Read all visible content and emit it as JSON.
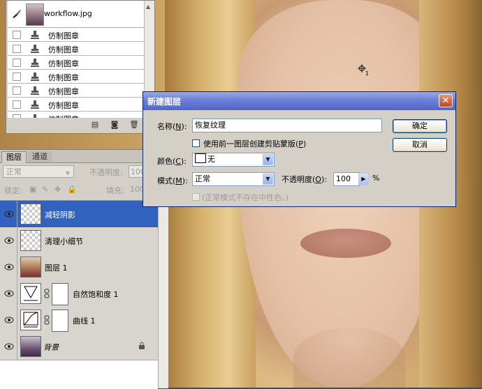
{
  "history": {
    "snapshot_name": "workflow.jpg",
    "items": [
      "仿制图章",
      "仿制图章",
      "仿制图章",
      "仿制图章",
      "仿制图章",
      "仿制图章",
      "仿制图章"
    ]
  },
  "layers_panel": {
    "tabs": [
      "图层",
      "通道"
    ],
    "blend_mode": "正常",
    "opacity_label": "不透明度:",
    "opacity_value": "100%",
    "lock_label": "锁定:",
    "fill_label": "填充:",
    "fill_value": "100%",
    "layers": [
      {
        "name": "减轻阴影",
        "selected": true,
        "kind": "transparent"
      },
      {
        "name": "清理小细节",
        "selected": false,
        "kind": "transparent"
      },
      {
        "name": "图层 1",
        "selected": false,
        "kind": "photo"
      },
      {
        "name": "自然饱和度 1",
        "selected": false,
        "kind": "vibrance"
      },
      {
        "name": "曲线 1",
        "selected": false,
        "kind": "curves"
      },
      {
        "name": "背景",
        "selected": false,
        "kind": "background",
        "locked": true
      }
    ]
  },
  "dialog": {
    "title": "新建图层",
    "name_label": "名称(",
    "name_key": "N",
    "name_label_end": "):",
    "name_value": "恢复纹理",
    "use_prev_label": "使用前一图层创建剪贴蒙版(",
    "use_prev_key": "P",
    "use_prev_end": ")",
    "color_label": "颜色(",
    "color_key": "C",
    "color_label_end": "):",
    "color_value": "无",
    "mode_label": "模式(",
    "mode_key": "M",
    "mode_label_end": "):",
    "mode_value": "正常",
    "opacity_label": "不透明度(",
    "opacity_key": "O",
    "opacity_label_end": "):",
    "opacity_value": "100",
    "opacity_unit": "%",
    "neutral_label": "(正常模式不存在中性色。)",
    "ok_label": "确定",
    "cancel_label": "取消",
    "close_glyph": "✕"
  },
  "canvas": {
    "cursor_label": "1"
  }
}
